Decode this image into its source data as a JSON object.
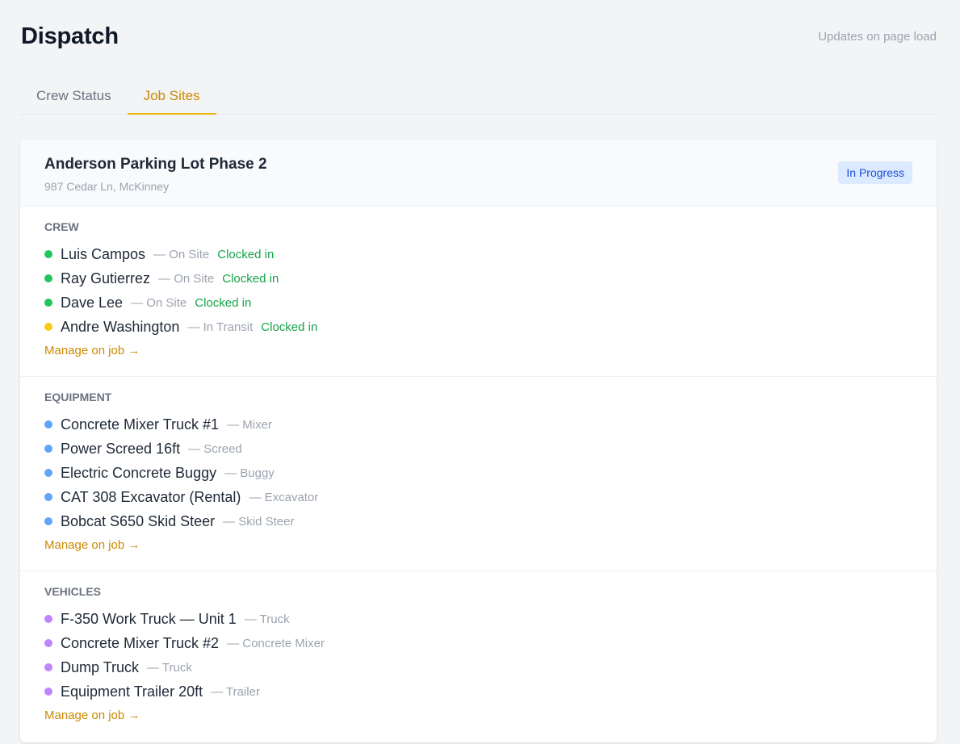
{
  "page": {
    "title": "Dispatch",
    "updates_note": "Updates on page load"
  },
  "tabs": [
    {
      "label": "Crew Status",
      "active": false
    },
    {
      "label": "Job Sites",
      "active": true
    }
  ],
  "site": {
    "name": "Anderson Parking Lot Phase 2",
    "address": "987 Cedar Ln, McKinney",
    "status": "In Progress"
  },
  "crew": {
    "title": "CREW",
    "items": [
      {
        "name": "Luis Campos",
        "location": "— On Site",
        "status": "Clocked in",
        "dot": "green"
      },
      {
        "name": "Ray Gutierrez",
        "location": "— On Site",
        "status": "Clocked in",
        "dot": "green"
      },
      {
        "name": "Dave Lee",
        "location": "— On Site",
        "status": "Clocked in",
        "dot": "green"
      },
      {
        "name": "Andre Washington",
        "location": "— In Transit",
        "status": "Clocked in",
        "dot": "yellow"
      }
    ],
    "manage_label": "Manage on job →"
  },
  "equipment": {
    "title": "EQUIPMENT",
    "items": [
      {
        "name": "Concrete Mixer Truck #1",
        "type": "— Mixer"
      },
      {
        "name": "Power Screed 16ft",
        "type": "— Screed"
      },
      {
        "name": "Electric Concrete Buggy",
        "type": "— Buggy"
      },
      {
        "name": "CAT 308 Excavator (Rental)",
        "type": "— Excavator"
      },
      {
        "name": "Bobcat S650 Skid Steer",
        "type": "— Skid Steer"
      }
    ],
    "manage_label": "Manage on job →"
  },
  "vehicles": {
    "title": "VEHICLES",
    "items": [
      {
        "name": "F-350 Work Truck — Unit 1",
        "type": "— Truck"
      },
      {
        "name": "Concrete Mixer Truck #2",
        "type": "— Concrete Mixer"
      },
      {
        "name": "Dump Truck",
        "type": "— Truck"
      },
      {
        "name": "Equipment Trailer 20ft",
        "type": "— Trailer"
      }
    ],
    "manage_label": "Manage on job →"
  },
  "colors": {
    "accent": "#ca8a04",
    "status_green": "#16a34a",
    "dot_green": "#22c55e",
    "dot_yellow": "#facc15",
    "dot_blue": "#60a5fa",
    "dot_purple": "#c084fc",
    "badge_bg": "#dbeafe",
    "badge_text": "#1d4ed8"
  }
}
